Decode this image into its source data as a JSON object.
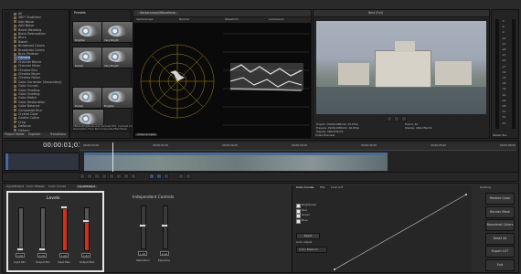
{
  "browser": {
    "tree": [
      "All",
      "360° Stabilizer",
      "Add Noise",
      "Add Noise",
      "Bevel Wedding",
      "Black Restoration",
      "Blurs",
      "Bokeh",
      "Broadcast Colors",
      "Broadcast Colors",
      "Burn Finisher",
      "Camera",
      "Channel Blend",
      "Channel Mixer",
      "Chroma Blur",
      "Chroma Keyer",
      "Chroma Noise",
      "Color Corrector (Secondary)",
      "Color Curves",
      "Color Grading",
      "Color Grading",
      "Color Match",
      "Color Restoration",
      "Color Balance",
      "Composite Blur",
      "Crystal Color",
      "Cookie Cutter",
      "Crop",
      "Defocus",
      "Deform"
    ],
    "selected_index": 11,
    "tabs": [
      "Project Media",
      "Explorer",
      "Transitions"
    ]
  },
  "presets": {
    "title": "Presets",
    "thumbs": [
      "Brighter",
      "Very Bright",
      "Darker",
      "Very Bright",
      "Darker",
      "Brighter",
      "Very Dark"
    ],
    "info": [
      "VEGAS Brightness and Contrast OFX, Contrast 1.0",
      "Description: From Red Composite Effect Basic"
    ]
  },
  "scopes": {
    "tab": "Vectorscope/Waveform",
    "left_labels": [
      "Vectorscope",
      "Normal"
    ],
    "right_labels": [
      "Waveform",
      "Luminance"
    ],
    "dropdown": "Video Scopes"
  },
  "preview": {
    "toolbar": "Best (Full)",
    "info_left": [
      "Project: 1920x1080x32, 29.970p",
      "Preview: 1920x1080x32, 29.970p",
      "Display: 460x259x32"
    ],
    "info_right": [
      "Frame: 30",
      "Display: 460x259x32"
    ],
    "tab": "Video Preview"
  },
  "meter": {
    "scale": [
      "-3",
      "-6",
      "-9",
      "-12",
      "-15",
      "-18",
      "-21",
      "-24",
      "-27",
      "-30",
      "-33",
      "-36",
      "-39",
      "-42",
      "-45",
      "-48",
      "-51",
      "-54",
      "-57"
    ],
    "tab": "Master Bus"
  },
  "timeline": {
    "timecode": "00:00:01;01",
    "ruler": [
      "00:00:00;00",
      "00:00:01;00",
      "00:00:02;00",
      "00:00:03;00",
      "00:00:04;00",
      "00:00:05;00",
      "00:00:06;00"
    ]
  },
  "grading": {
    "tabs": [
      "Input/Output",
      "Color Wheels",
      "Color Curves",
      "Input/Output"
    ],
    "active_tab": "Input/Output",
    "levels_title": "Levels",
    "sliders": [
      {
        "label": "Input Min",
        "value": "0.00",
        "level": 0.0
      },
      {
        "label": "Output Min",
        "value": "0.00",
        "level": 0.0
      },
      {
        "label": "Input Max",
        "value": "1.00",
        "level": 1.0
      },
      {
        "label": "Output Max",
        "value": "0.67",
        "level": 0.67
      }
    ],
    "independent_title": "Independent Controls",
    "independent": [
      {
        "label": "Saturation",
        "value": "1.00"
      },
      {
        "label": "Exposure",
        "value": "0.00"
      }
    ],
    "curve_tabs": [
      "Color Curves",
      "HSL",
      "Look LUT"
    ],
    "channels": [
      "Brightness",
      "Red",
      "Green",
      "Blue"
    ],
    "reset_label": "Reset",
    "auto_adjust_label": "Auto Adjust",
    "auto_adjust_value": "Color Balance",
    "modes_title": "Grading",
    "buttons": [
      "Restore Color Grading",
      "Render Mask",
      "Broadcast Colors",
      "Reset All",
      "Export LUT",
      "Exit"
    ]
  }
}
